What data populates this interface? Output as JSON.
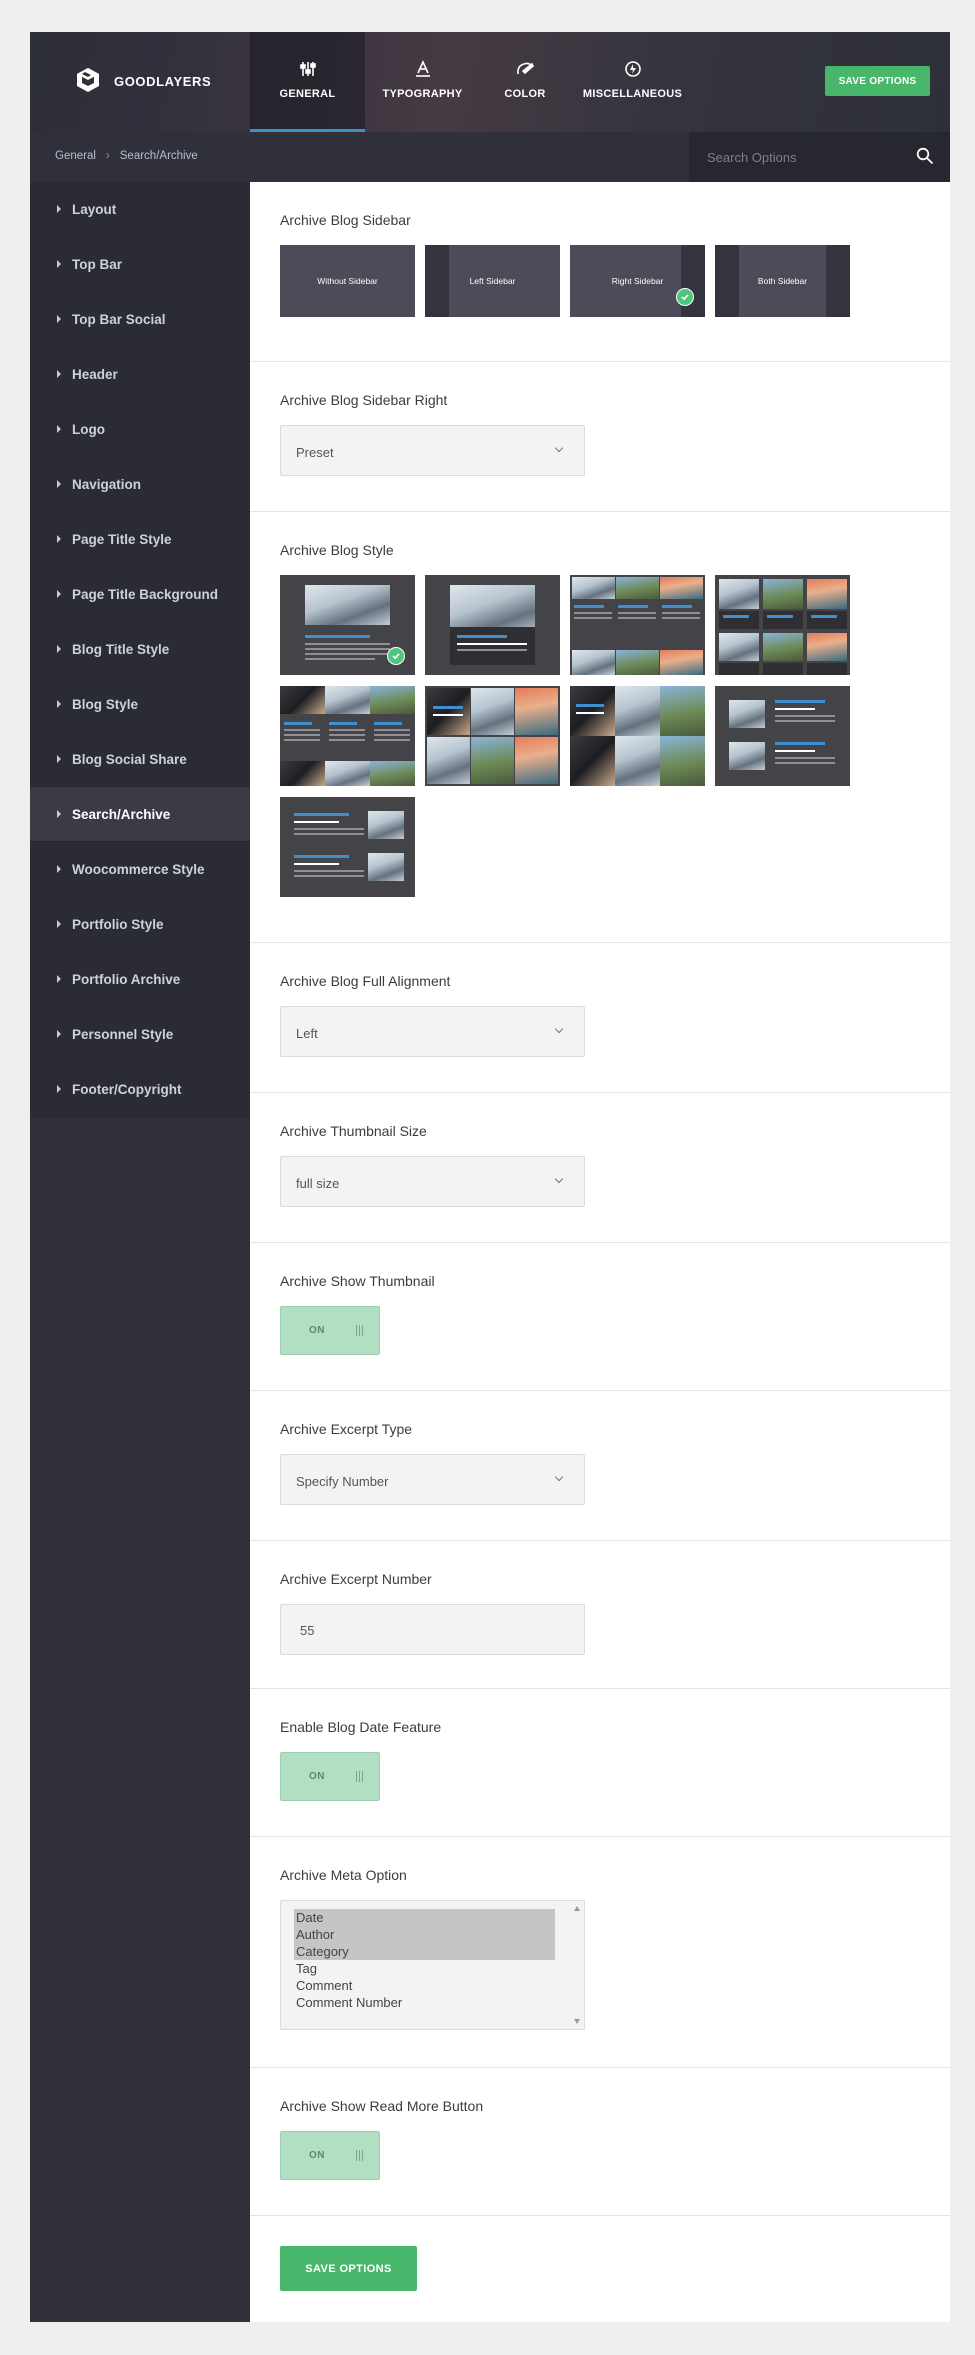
{
  "app": {
    "brand": "GOODLAYERS"
  },
  "tabs": [
    {
      "label": "GENERAL",
      "icon": "sliders-icon",
      "active": true
    },
    {
      "label": "TYPOGRAPHY",
      "icon": "typography-icon"
    },
    {
      "label": "COLOR",
      "icon": "color-brush-icon"
    },
    {
      "label": "MISCELLANEOUS",
      "icon": "misc-icon"
    }
  ],
  "header": {
    "save_label": "SAVE OPTIONS"
  },
  "breadcrumb": {
    "root": "General",
    "separator": "›",
    "current": "Search/Archive"
  },
  "search": {
    "placeholder": "Search Options",
    "value": ""
  },
  "sidebar": {
    "active": "Search/Archive",
    "items": [
      {
        "label": "Layout"
      },
      {
        "label": "Top Bar"
      },
      {
        "label": "Top Bar Social"
      },
      {
        "label": "Header"
      },
      {
        "label": "Logo"
      },
      {
        "label": "Navigation"
      },
      {
        "label": "Page Title Style"
      },
      {
        "label": "Page Title Background"
      },
      {
        "label": "Blog Title Style"
      },
      {
        "label": "Blog Style"
      },
      {
        "label": "Blog Social Share"
      },
      {
        "label": "Search/Archive"
      },
      {
        "label": "Woocommerce Style"
      },
      {
        "label": "Portfolio Style"
      },
      {
        "label": "Portfolio Archive"
      },
      {
        "label": "Personnel Style"
      },
      {
        "label": "Footer/Copyright"
      }
    ]
  },
  "main": {
    "sidebar_layout": {
      "title": "Archive Blog Sidebar",
      "options": [
        {
          "label": "Without Sidebar"
        },
        {
          "label": "Left Sidebar"
        },
        {
          "label": "Right Sidebar",
          "selected": true
        },
        {
          "label": "Both Sidebar"
        }
      ]
    },
    "sidebar_right": {
      "title": "Archive Blog Sidebar Right",
      "value": "Preset"
    },
    "blog_style": {
      "title": "Archive Blog Style",
      "selected_index": 0,
      "option_count": 9
    },
    "full_alignment": {
      "title": "Archive Blog Full Alignment",
      "value": "Left"
    },
    "thumbnail_size": {
      "title": "Archive Thumbnail Size",
      "value": "full size"
    },
    "show_thumbnail": {
      "title": "Archive Show Thumbnail",
      "value": "ON"
    },
    "excerpt_type": {
      "title": "Archive Excerpt Type",
      "value": "Specify Number"
    },
    "excerpt_number": {
      "title": "Archive Excerpt Number",
      "value": "55"
    },
    "date_feature": {
      "title": "Enable Blog Date Feature",
      "value": "ON"
    },
    "meta_option": {
      "title": "Archive Meta Option",
      "options": [
        {
          "label": "Date",
          "selected": true
        },
        {
          "label": "Author",
          "selected": true
        },
        {
          "label": "Category",
          "selected": true
        },
        {
          "label": "Tag",
          "selected": false
        },
        {
          "label": "Comment",
          "selected": false
        },
        {
          "label": "Comment Number",
          "selected": false
        }
      ]
    },
    "read_more": {
      "title": "Archive Show Read More Button",
      "value": "ON"
    },
    "save_label": "SAVE OPTIONS"
  },
  "colors": {
    "accent_green": "#48b76c",
    "accent_blue": "#3e8fd0",
    "sidebar_bg": "#2f3039"
  }
}
